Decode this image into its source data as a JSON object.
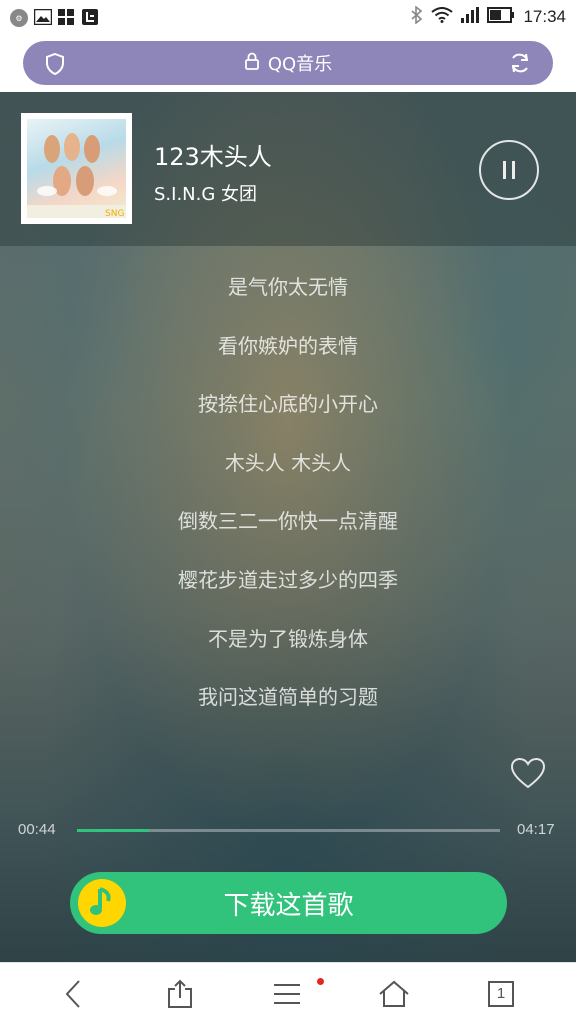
{
  "status_bar": {
    "time": "17:34",
    "left_icons": [
      "settings-app-icon",
      "gallery-icon",
      "apps-icon",
      "letv-icon"
    ],
    "right_icons": [
      "bluetooth-icon",
      "wifi-icon",
      "signal-icon",
      "battery-icon"
    ]
  },
  "url_bar": {
    "title": "QQ音乐",
    "left_icon": "shield-icon",
    "right_icon": "refresh-icon"
  },
  "player": {
    "song_title": "123木头人",
    "artist": "S.I.N.G 女团",
    "cover_icon": "album-cover",
    "play_state_icon": "pause-icon",
    "lyrics": [
      "是气你太无情",
      "看你嫉妒的表情",
      "按捺住心底的小开心",
      "木头人 木头人",
      "倒数三二一你快一点清醒",
      "樱花步道走过多少的四季",
      "不是为了锻炼身体",
      "我问这道简单的习题"
    ],
    "favorite_icon": "heart-icon",
    "time_current": "00:44",
    "time_total": "04:17",
    "progress_fraction": 0.171,
    "download_label": "下载这首歌",
    "download_icon": "qq-music-logo-icon"
  },
  "bottom_nav": {
    "items": [
      "back-icon",
      "share-icon",
      "menu-icon",
      "home-icon",
      "tabs-icon"
    ],
    "tabs_count": "1",
    "menu_has_notification": true
  },
  "colors": {
    "accent_green": "#31c27c",
    "url_bar": "#8e86b8",
    "notification_red": "#e0281f"
  }
}
